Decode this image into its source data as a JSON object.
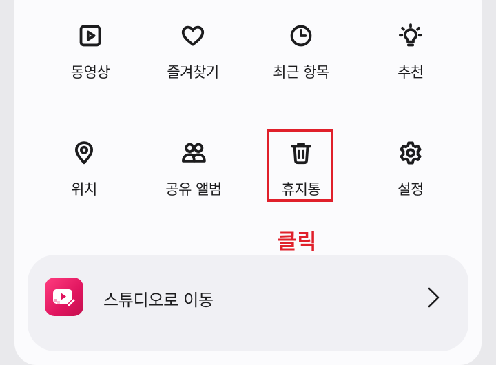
{
  "menu": {
    "items": [
      {
        "label": "동영상",
        "icon": "video-icon"
      },
      {
        "label": "즐겨찾기",
        "icon": "heart-icon"
      },
      {
        "label": "최근 항목",
        "icon": "clock-icon"
      },
      {
        "label": "추천",
        "icon": "lightbulb-icon"
      },
      {
        "label": "위치",
        "icon": "location-pin-icon"
      },
      {
        "label": "공유 앨범",
        "icon": "people-icon"
      },
      {
        "label": "휴지통",
        "icon": "trash-icon"
      },
      {
        "label": "설정",
        "icon": "gear-icon"
      }
    ]
  },
  "annotation": {
    "text": "클릭",
    "color": "#e0202b",
    "target": "휴지통"
  },
  "studio": {
    "label": "스튜디오로 이동",
    "icon": "studio-app-icon",
    "accent": "#e0155f"
  }
}
